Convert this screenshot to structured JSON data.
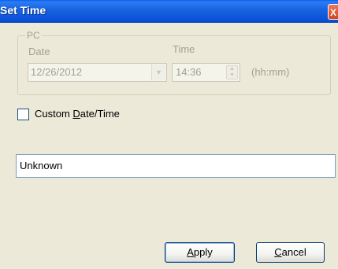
{
  "window": {
    "title": "Set Time",
    "close_glyph": "X"
  },
  "pc_group": {
    "legend": "PC",
    "date_label": "Date",
    "date_value": "12/26/2012",
    "time_label": "Time",
    "time_value": "14:36",
    "time_format": "(hh:mm)"
  },
  "custom": {
    "checked": false,
    "label_prefix": "Custom ",
    "label_accel": "D",
    "label_suffix": "ate/Time"
  },
  "status_field": {
    "value": "Unknown"
  },
  "buttons": {
    "apply_accel": "A",
    "apply_rest": "pply",
    "cancel_accel": "C",
    "cancel_rest": "ancel"
  },
  "icons": {
    "close": "close-icon",
    "dropdown": "chevron-down-icon",
    "spinner": "spinner-icon"
  }
}
